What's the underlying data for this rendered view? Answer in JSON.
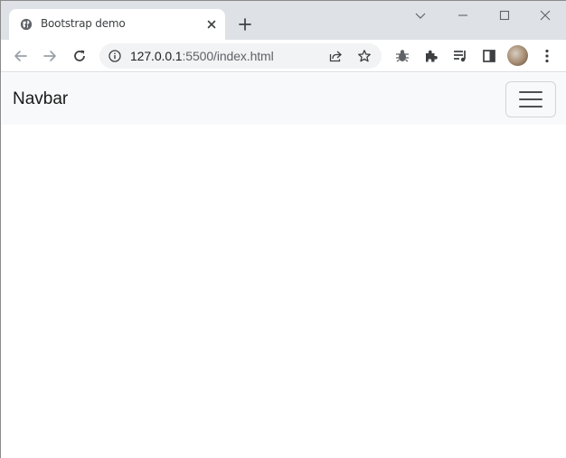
{
  "browser": {
    "tab": {
      "title": "Bootstrap demo",
      "favicon": "globe-icon",
      "close": "close-icon"
    },
    "new_tab": "plus-icon",
    "window_controls": [
      "tab-search-icon",
      "minimize-icon",
      "maximize-icon",
      "close-icon"
    ],
    "toolbar": {
      "back": "arrow-left-icon",
      "forward": "arrow-right-icon",
      "reload": "reload-icon",
      "site_info": "info-icon",
      "url_host": "127.0.0.1",
      "url_rest": ":5500/index.html",
      "share": "share-icon",
      "bookmark": "star-icon",
      "extensions": [
        "bug-icon",
        "puzzle-icon",
        "media-control-icon",
        "side-panel-icon"
      ],
      "profile": "avatar",
      "menu": "kebab-menu-icon"
    }
  },
  "page": {
    "navbar": {
      "brand": "Navbar",
      "toggler": "hamburger-icon"
    }
  },
  "colors": {
    "tabstrip": "#dee1e6",
    "navbar_bg": "#f8f9fa",
    "omnibox_bg": "#f1f3f4"
  }
}
